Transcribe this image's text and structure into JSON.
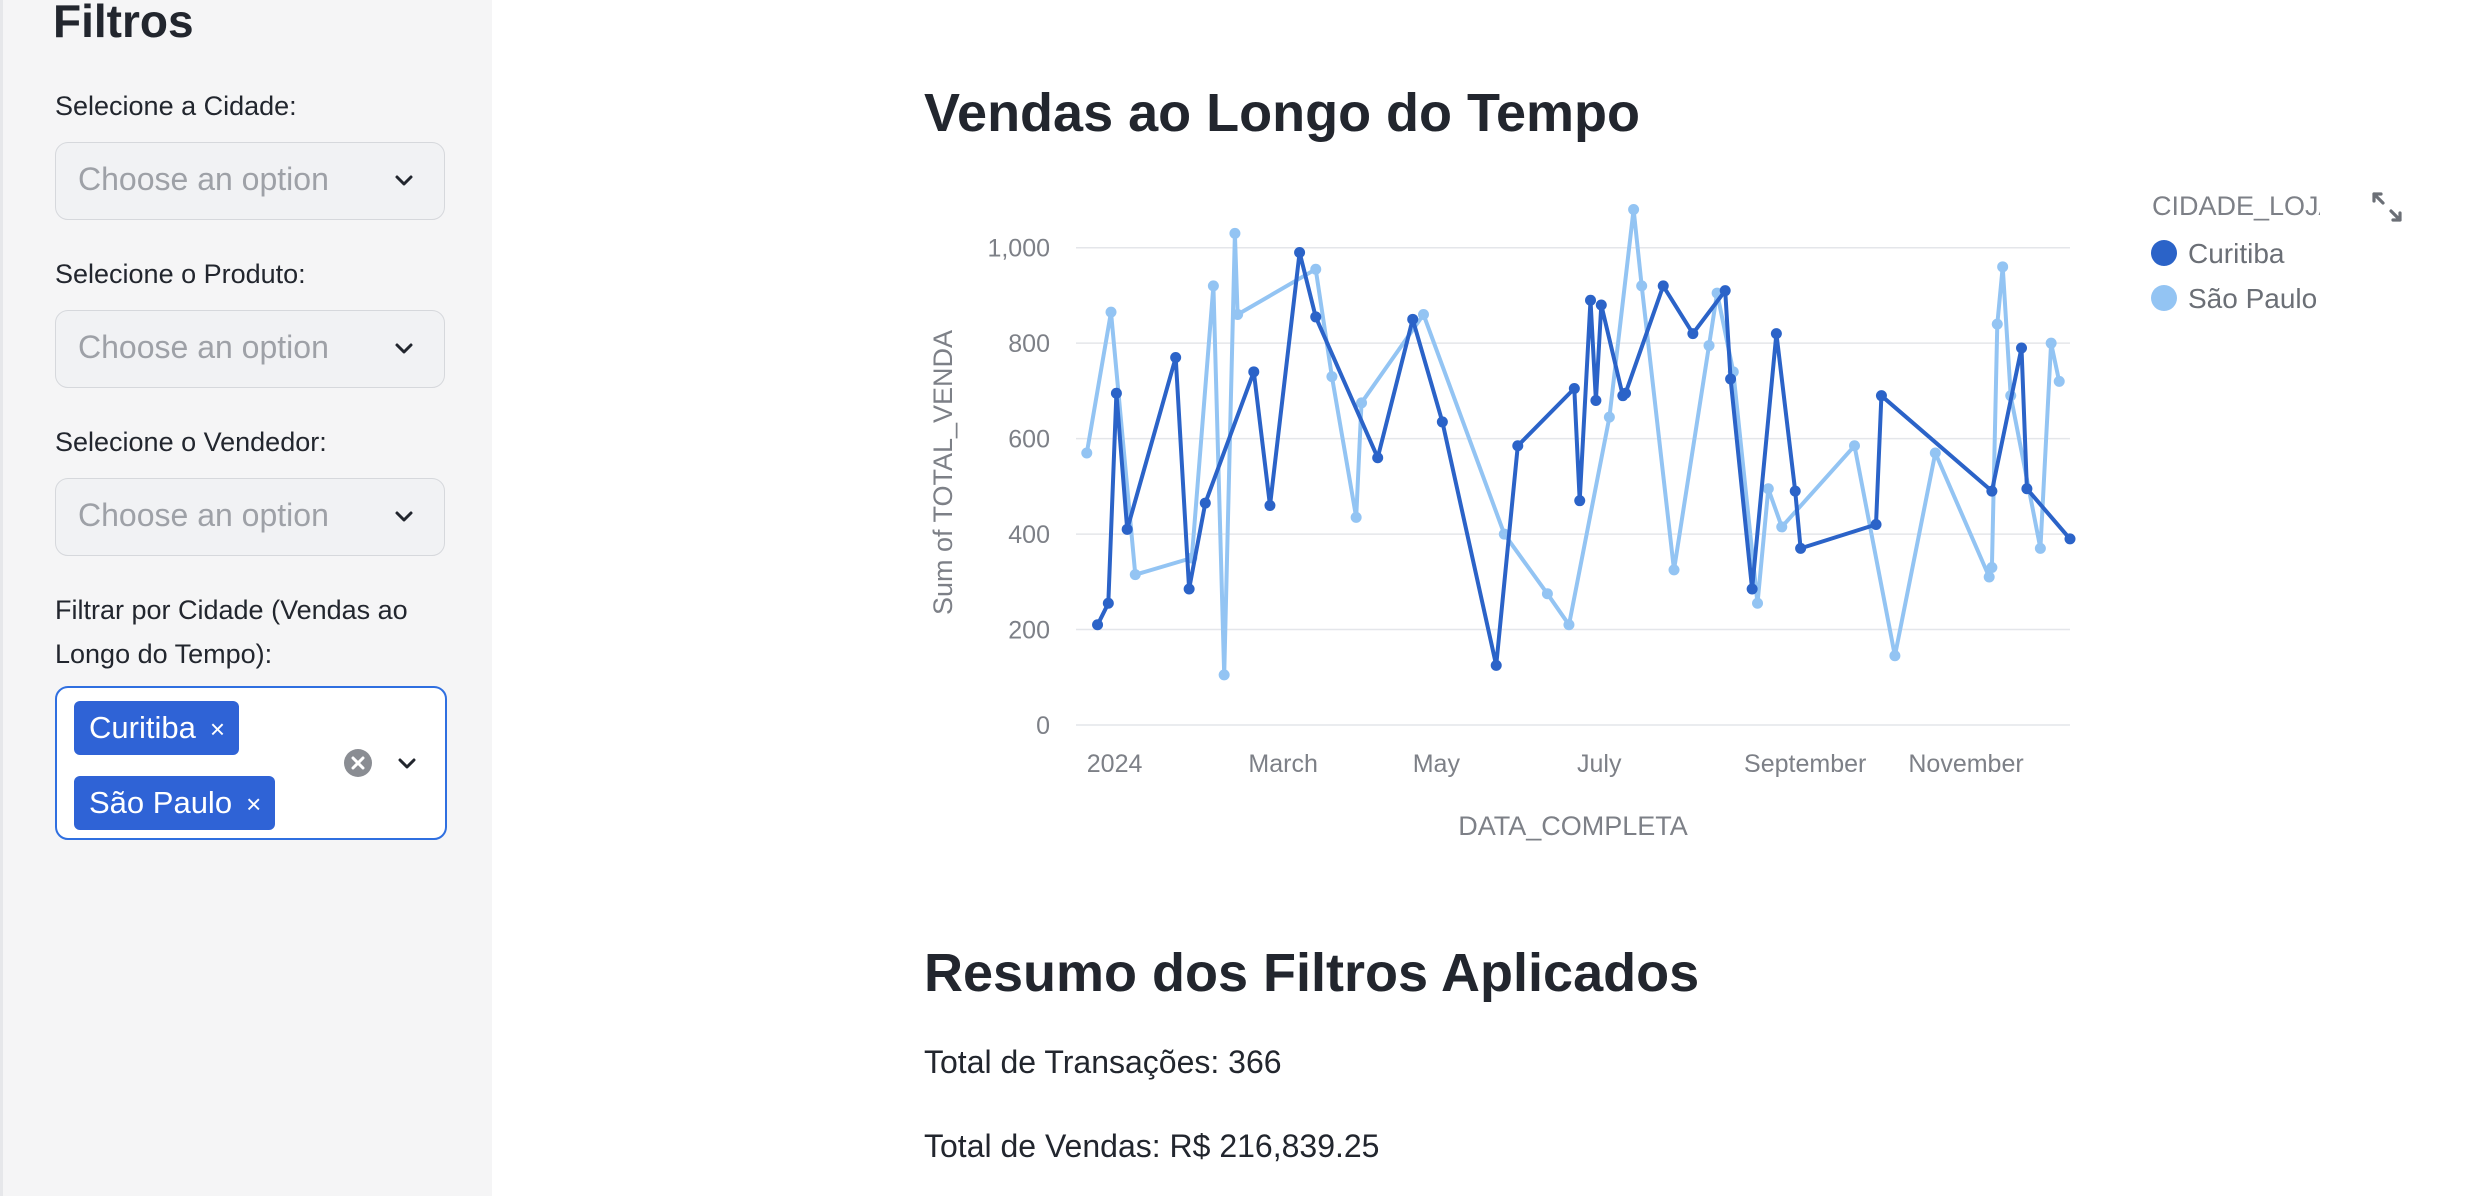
{
  "sidebar": {
    "title": "Filtros",
    "city_filter": {
      "label": "Selecione a Cidade:",
      "placeholder": "Choose an option"
    },
    "product_filter": {
      "label": "Selecione o Produto:",
      "placeholder": "Choose an option"
    },
    "seller_filter": {
      "label": "Selecione o Vendedor:",
      "placeholder": "Choose an option"
    },
    "time_city_filter": {
      "label_line1": "Filtrar por Cidade (Vendas ao",
      "label_line2": "Longo do Tempo):",
      "tags": [
        "Curitiba",
        "São Paulo"
      ],
      "remove_symbol": "×"
    }
  },
  "main": {
    "chart_title": "Vendas ao Longo do Tempo",
    "summary_title": "Resumo dos Filtros Aplicados",
    "transactions": {
      "label": "Total de Transações:",
      "value": "366"
    },
    "sales": {
      "label": "Total de Vendas:",
      "value": "R$ 216,839.25"
    }
  },
  "chart_data": {
    "type": "line",
    "xlabel": "DATA_COMPLETA",
    "ylabel": "Sum of TOTAL_VENDA",
    "ylim": [
      0,
      1100
    ],
    "yticks": [
      0,
      200,
      400,
      600,
      800,
      1000
    ],
    "ytick_labels": [
      "0",
      "200",
      "400",
      "600",
      "800",
      "1,000"
    ],
    "xlim": [
      "2023-12-28",
      "2024-12-31"
    ],
    "xticks": [
      {
        "date": "2024-01-01",
        "label": "2024"
      },
      {
        "date": "2024-03-01",
        "label": "March"
      },
      {
        "date": "2024-05-01",
        "label": "May"
      },
      {
        "date": "2024-07-01",
        "label": "July"
      },
      {
        "date": "2024-09-01",
        "label": "September"
      },
      {
        "date": "2024-11-01",
        "label": "November"
      }
    ],
    "legend_title": "CIDADE_LOJA",
    "legend_position": "top-right",
    "grid": true,
    "series": [
      {
        "name": "Curitiba",
        "color": "#2b63c8",
        "points": [
          [
            "2024-01-05",
            210
          ],
          [
            "2024-01-09",
            255
          ],
          [
            "2024-01-12",
            695
          ],
          [
            "2024-01-16",
            410
          ],
          [
            "2024-02-03",
            770
          ],
          [
            "2024-02-08",
            285
          ],
          [
            "2024-02-14",
            465
          ],
          [
            "2024-03-03",
            740
          ],
          [
            "2024-03-09",
            460
          ],
          [
            "2024-03-20",
            990
          ],
          [
            "2024-03-26",
            855
          ],
          [
            "2024-04-18",
            560
          ],
          [
            "2024-05-01",
            850
          ],
          [
            "2024-05-12",
            635
          ],
          [
            "2024-06-01",
            125
          ],
          [
            "2024-06-09",
            585
          ],
          [
            "2024-06-30",
            705
          ],
          [
            "2024-07-02",
            470
          ],
          [
            "2024-07-06",
            890
          ],
          [
            "2024-07-08",
            680
          ],
          [
            "2024-07-10",
            880
          ],
          [
            "2024-07-18",
            690
          ],
          [
            "2024-07-19",
            695
          ],
          [
            "2024-08-02",
            920
          ],
          [
            "2024-08-13",
            820
          ],
          [
            "2024-08-25",
            910
          ],
          [
            "2024-08-27",
            725
          ],
          [
            "2024-09-04",
            285
          ],
          [
            "2024-09-13",
            820
          ],
          [
            "2024-09-20",
            490
          ],
          [
            "2024-09-22",
            370
          ],
          [
            "2024-10-20",
            420
          ],
          [
            "2024-10-22",
            690
          ],
          [
            "2024-12-02",
            490
          ],
          [
            "2024-12-13",
            790
          ],
          [
            "2024-12-15",
            495
          ],
          [
            "2024-12-31",
            390
          ]
        ]
      },
      {
        "name": "São Paulo",
        "color": "#93c4f3",
        "points": [
          [
            "2024-01-01",
            570
          ],
          [
            "2024-01-10",
            865
          ],
          [
            "2024-01-19",
            315
          ],
          [
            "2024-02-09",
            350
          ],
          [
            "2024-02-17",
            920
          ],
          [
            "2024-02-21",
            105
          ],
          [
            "2024-02-25",
            1030
          ],
          [
            "2024-02-26",
            860
          ],
          [
            "2024-03-26",
            955
          ],
          [
            "2024-04-01",
            730
          ],
          [
            "2024-04-10",
            435
          ],
          [
            "2024-04-12",
            675
          ],
          [
            "2024-05-05",
            860
          ],
          [
            "2024-06-04",
            400
          ],
          [
            "2024-06-20",
            275
          ],
          [
            "2024-06-28",
            210
          ],
          [
            "2024-07-13",
            645
          ],
          [
            "2024-07-22",
            1080
          ],
          [
            "2024-07-25",
            920
          ],
          [
            "2024-08-06",
            325
          ],
          [
            "2024-08-19",
            795
          ],
          [
            "2024-08-22",
            905
          ],
          [
            "2024-08-28",
            740
          ],
          [
            "2024-09-06",
            255
          ],
          [
            "2024-09-10",
            495
          ],
          [
            "2024-09-15",
            415
          ],
          [
            "2024-10-12",
            585
          ],
          [
            "2024-10-27",
            145
          ],
          [
            "2024-11-11",
            570
          ],
          [
            "2024-12-01",
            310
          ],
          [
            "2024-12-02",
            330
          ],
          [
            "2024-12-04",
            840
          ],
          [
            "2024-12-06",
            960
          ],
          [
            "2024-12-09",
            690
          ],
          [
            "2024-12-20",
            370
          ],
          [
            "2024-12-24",
            800
          ],
          [
            "2024-12-27",
            720
          ]
        ]
      }
    ]
  }
}
